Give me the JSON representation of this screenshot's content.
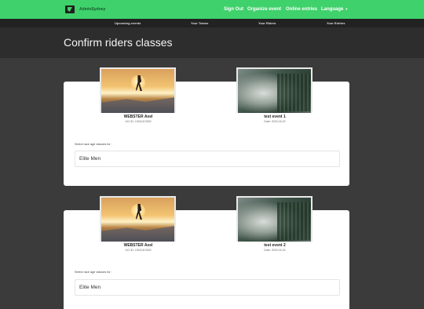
{
  "header": {
    "brand": "AdminSydney",
    "nav": [
      "Sign Out",
      "Organize event",
      "Online entries",
      "Language"
    ]
  },
  "subnav": [
    "Upcoming events",
    "Your Teams",
    "Your Riders",
    "Your Entries"
  ],
  "page": {
    "title": "Confirm riders classes"
  },
  "colors": {
    "accent": "#3fd16b",
    "dark": "#2d2d2d",
    "panel": "#ffffff"
  },
  "entries": [
    {
      "rider_name": "WEBSTER Axel",
      "rider_uci": "UCI ID: 10011113392",
      "event_name": "test event 1",
      "event_date": "Date: 2019-03-22",
      "select_label": "Select race age classes for :",
      "selected_class": "Elite Men"
    },
    {
      "rider_name": "WEBSTER Axel",
      "rider_uci": "UCI ID: 10011113392",
      "event_name": "test event 2",
      "event_date": "Date: 2019-03-24",
      "select_label": "Select race age classes for :",
      "selected_class": "Elite Men"
    }
  ]
}
